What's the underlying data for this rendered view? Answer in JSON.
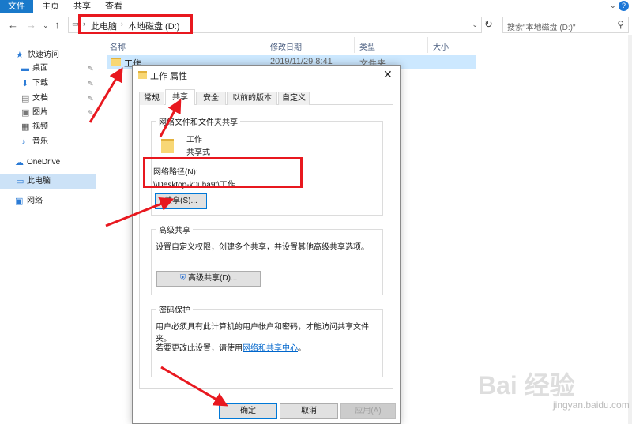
{
  "ribbon": {
    "tabs": [
      "文件",
      "主页",
      "共享",
      "查看"
    ]
  },
  "address": {
    "segments": [
      "此电脑",
      "本地磁盘 (D:)"
    ],
    "search_placeholder": "搜索\"本地磁盘 (D:)\""
  },
  "sidebar": {
    "items": [
      {
        "label": "快速访问",
        "icon": "star-icon"
      },
      {
        "label": "桌面",
        "icon": "desktop-icon"
      },
      {
        "label": "下载",
        "icon": "download-icon"
      },
      {
        "label": "文档",
        "icon": "document-icon"
      },
      {
        "label": "图片",
        "icon": "picture-icon"
      },
      {
        "label": "视频",
        "icon": "video-icon"
      },
      {
        "label": "音乐",
        "icon": "music-icon"
      },
      {
        "label": "OneDrive",
        "icon": "cloud-icon"
      },
      {
        "label": "此电脑",
        "icon": "computer-icon"
      },
      {
        "label": "网络",
        "icon": "network-icon"
      }
    ]
  },
  "filelist": {
    "columns": [
      "名称",
      "修改日期",
      "类型",
      "大小"
    ],
    "rows": [
      {
        "name": "工作",
        "date": "2019/11/29 8:41",
        "type": "文件夹"
      }
    ]
  },
  "dialog": {
    "title": "工作 属性",
    "tabs": [
      "常规",
      "共享",
      "安全",
      "以前的版本",
      "自定义"
    ],
    "active_tab": "共享",
    "network_share": {
      "group_title": "网络文件和文件夹共享",
      "folder_name": "工作",
      "share_state": "共享式",
      "path_label": "网络路径(N):",
      "path_value": "\\\\Desktop-k0uha9t\\工作",
      "share_button": "共享(S)..."
    },
    "advanced": {
      "group_title": "高级共享",
      "description": "设置自定义权限，创建多个共享，并设置其他高级共享选项。",
      "button": "高级共享(D)..."
    },
    "password": {
      "group_title": "密码保护",
      "description": "用户必须具有此计算机的用户帐户和密码，才能访问共享文件夹。",
      "change_prefix": "若要更改此设置，请使用",
      "change_link": "网络和共享中心",
      "change_suffix": "。"
    },
    "buttons": {
      "ok": "确定",
      "cancel": "取消",
      "apply": "应用(A)"
    }
  },
  "watermark": {
    "brand": "Bai 经验",
    "url": "jingyan.baidu.com"
  },
  "colors": {
    "accent": "#1979ca",
    "highlight_red": "#e8181f",
    "selection": "#cce8ff"
  }
}
